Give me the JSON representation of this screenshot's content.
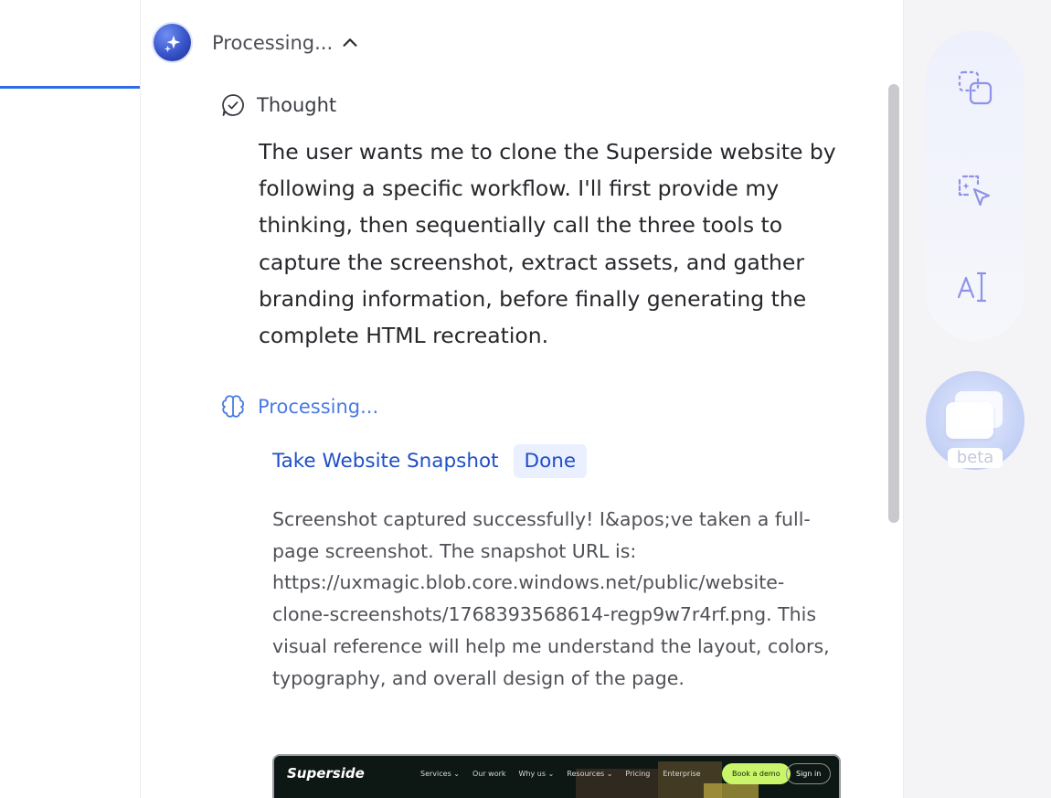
{
  "header": {
    "status": "Processing...",
    "avatar_icon": "sparkle-icon",
    "toggle_icon": "chevron-up-icon"
  },
  "thought": {
    "title": "Thought",
    "icon": "check-circle-bubble-icon",
    "body": "The user wants me to clone the Superside website by following a specific workflow. I'll first provide my thinking, then sequentially call the three tools to capture the screenshot, extract assets, and gather branding information, before finally generating the complete HTML recreation."
  },
  "processing": {
    "title": "Processing...",
    "icon": "brain-icon",
    "tool": {
      "name": "Take Website Snapshot",
      "status": "Done",
      "result": "Screenshot captured successfully! I&apos;ve taken a full-page screenshot. The snapshot URL is: https://uxmagic.blob.core.windows.net/public/website-clone-screenshots/1768393568614-regp9w7r4rf.png. This visual reference will help me understand the layout, colors, typography, and overall design of the page."
    }
  },
  "snapshot_preview": {
    "logo": "Superside",
    "menu": [
      "Services ⌄",
      "Our work",
      "Why us ⌄",
      "Resources ⌄",
      "Pricing",
      "Enterprise"
    ],
    "cta": "Book a demo",
    "signin": "Sign in"
  },
  "right_rail": {
    "tools": [
      {
        "name": "duplicate-icon"
      },
      {
        "name": "select-magic-icon"
      },
      {
        "name": "text-edit-icon"
      }
    ],
    "beta_label": "beta"
  },
  "colors": {
    "accent": "#2e6be6",
    "link": "#1f4fc8",
    "processing": "#4a7be0",
    "rail_icon": "#8e92e8"
  }
}
